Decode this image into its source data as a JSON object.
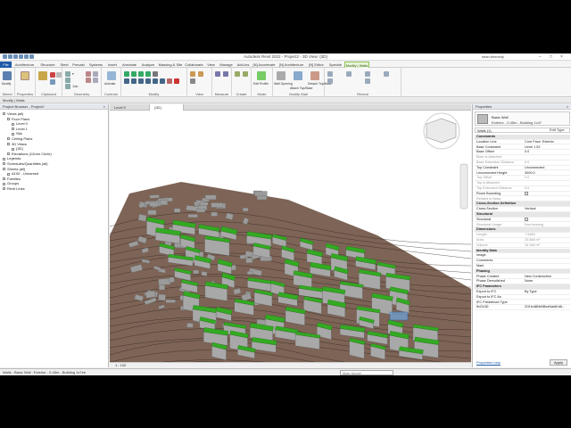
{
  "title_bar": {
    "title": "Autodesk Revit 2022 - Project2 - 3D View: {3D}",
    "user": "sean.kennedy"
  },
  "ribbon": {
    "tabs": [
      "File",
      "Architecture",
      "Structure",
      "Steel",
      "Precast",
      "Systems",
      "Insert",
      "Annotate",
      "Analyze",
      "Massing & Site",
      "Collaborate",
      "View",
      "Manage",
      "Add-Ins",
      "[N] Accelerate",
      "[N] Architecture",
      "[N] Editor",
      "Speckle",
      "Modify | Walls"
    ],
    "active_tab": "Modify | Walls",
    "panels": [
      "Select",
      "Properties",
      "Clipboard",
      "Geometry",
      "Controls",
      "Modify",
      "View",
      "Measure",
      "Create",
      "Mode",
      "Modify Wall",
      "Reveal"
    ],
    "buttons": {
      "modify": "Modify",
      "properties": "Properties",
      "paste": "Paste",
      "join": "Join",
      "activate": "Activate",
      "edit_profile": "Edit Profile",
      "reset_profile": "Reset Profile",
      "wall_opening": "Wall Opening",
      "attach": "Attach Top/Base",
      "detach": "Detach Top/Base"
    }
  },
  "context_bar": "Modify | Walls",
  "project_browser": {
    "title": "Project Browser - Project2",
    "items": [
      {
        "label": "Views (all)",
        "level": 0
      },
      {
        "label": "Floor Plans",
        "level": 1
      },
      {
        "label": "Level 0",
        "level": 2
      },
      {
        "label": "Level 1",
        "level": 2
      },
      {
        "label": "Site",
        "level": 2
      },
      {
        "label": "Ceiling Plans",
        "level": 1
      },
      {
        "label": "3D Views",
        "level": 1
      },
      {
        "label": "{3D}",
        "level": 2
      },
      {
        "label": "Elevations (12mm Circle)",
        "level": 1
      },
      {
        "label": "Legends",
        "level": 0
      },
      {
        "label": "Schedules/Quantities (all)",
        "level": 0
      },
      {
        "label": "Sheets (all)",
        "level": 0
      },
      {
        "label": "A100 - Unnamed",
        "level": 1
      },
      {
        "label": "Families",
        "level": 0
      },
      {
        "label": "Groups",
        "level": 0
      },
      {
        "label": "Revit Links",
        "level": 0
      }
    ]
  },
  "view_tabs": [
    "Level 0",
    "{3D}"
  ],
  "view_control": {
    "scale": "1 : 100"
  },
  "properties": {
    "title": "Properties",
    "family": "Basic Wall",
    "type": "Exterior - 0.45m - Building 1x47",
    "instance_selector": "Walls (1)",
    "edit_type": "Edit Type",
    "rows": [
      {
        "kind": "section",
        "label": "Constraints"
      },
      {
        "label": "Location Line",
        "value": "Core Face: Exterior"
      },
      {
        "label": "Base Constraint",
        "value": "Level 1 52"
      },
      {
        "label": "Base Offset",
        "value": "0.0"
      },
      {
        "label": "Base is Attached",
        "value": "",
        "gray": true
      },
      {
        "label": "Base Extension Distance",
        "value": "0.0",
        "gray": true
      },
      {
        "label": "Top Constraint",
        "value": "Unconnected"
      },
      {
        "label": "Unconnected Height",
        "value": "3000.0"
      },
      {
        "label": "Top Offset",
        "value": "0.0",
        "gray": true
      },
      {
        "label": "Top is Attached",
        "value": "",
        "gray": true
      },
      {
        "label": "Top Extension Distance",
        "value": "0.0",
        "gray": true
      },
      {
        "label": "Room Bounding",
        "value": "",
        "check": true
      },
      {
        "label": "Related to Mass",
        "value": "",
        "gray": true
      },
      {
        "kind": "section",
        "label": "Cross-Section Definition"
      },
      {
        "label": "Cross-Section",
        "value": "Vertical"
      },
      {
        "kind": "section",
        "label": "Structural"
      },
      {
        "label": "Structural",
        "value": "",
        "check": true
      },
      {
        "label": "Structural Usage",
        "value": "Non-bearing",
        "gray": true
      },
      {
        "kind": "section",
        "label": "Dimensions"
      },
      {
        "label": "Length",
        "value": "7.5466",
        "gray": true
      },
      {
        "label": "Area",
        "value": "20.888 m²",
        "gray": true
      },
      {
        "label": "Volume",
        "value": "16.188 m³",
        "gray": true
      },
      {
        "kind": "section",
        "label": "Identity Data"
      },
      {
        "label": "Image",
        "value": ""
      },
      {
        "label": "Comments",
        "value": ""
      },
      {
        "label": "Mark",
        "value": ""
      },
      {
        "kind": "section",
        "label": "Phasing"
      },
      {
        "label": "Phase Created",
        "value": "New Construction"
      },
      {
        "label": "Phase Demolished",
        "value": "None"
      },
      {
        "kind": "section",
        "label": "IFC Parameters"
      },
      {
        "label": "Export to IFC",
        "value": "By Type"
      },
      {
        "label": "Export to IFC As",
        "value": ""
      },
      {
        "label": "IFC Predefined Type",
        "value": ""
      },
      {
        "label": "IfcGUID",
        "value": "2GHvd8Nb0BxeNaldKd6..."
      }
    ],
    "help": "Properties help",
    "apply": "Apply"
  },
  "status_bar": {
    "text": "Walls : Basic Wall : Exterior - 0.45m - Building 1x7ee",
    "main_model": "Main Model"
  },
  "colors": {
    "terrain": "#7d6456",
    "roof": "#33aa22",
    "wall": "#a8a8a8",
    "file_tab": "#1e5aa8"
  }
}
